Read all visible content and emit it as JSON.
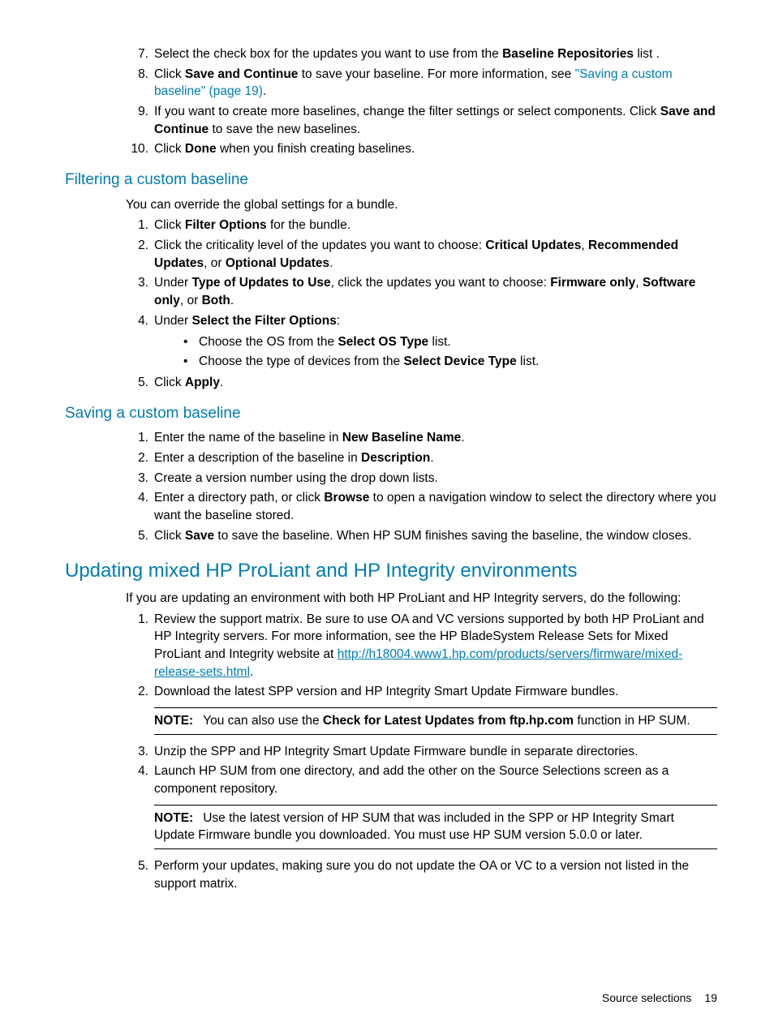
{
  "top_list": {
    "i7": {
      "num": "7.",
      "pre": "Select the check box for the updates you want to use from the ",
      "b1": "Baseline Repositories",
      "post": " list ."
    },
    "i8": {
      "num": "8.",
      "pre": "Click ",
      "b1": "Save and Continue",
      "mid": " to save your baseline. For more information, see ",
      "xref": "\"Saving a custom baseline\" (page 19)",
      "post": "."
    },
    "i9": {
      "num": "9.",
      "pre": "If you want to create more baselines, change the filter settings or select components. Click ",
      "b1": "Save and Continue",
      "post": " to save the new baselines."
    },
    "i10": {
      "num": "10.",
      "pre": "Click ",
      "b1": "Done",
      "post": " when you finish creating baselines."
    }
  },
  "sec_filter": {
    "title": "Filtering a custom baseline",
    "intro": "You can override the global settings for a bundle.",
    "i1": {
      "num": "1.",
      "pre": "Click ",
      "b1": "Filter Options",
      "post": " for the bundle."
    },
    "i2": {
      "num": "2.",
      "pre": "Click the criticality level of the updates you want to choose: ",
      "b1": "Critical Updates",
      "mid1": ", ",
      "b2": "Recommended Updates",
      "mid2": ", or ",
      "b3": "Optional Updates",
      "post": "."
    },
    "i3": {
      "num": "3.",
      "pre": "Under ",
      "b1": "Type of Updates to Use",
      "mid1": ", click the updates you want to choose: ",
      "b2": "Firmware only",
      "mid2": ", ",
      "b3": "Software only",
      "mid3": ", or ",
      "b4": "Both",
      "post": "."
    },
    "i4": {
      "num": "4.",
      "pre": "Under ",
      "b1": "Select the Filter Options",
      "post": ":"
    },
    "i4s1": {
      "pre": "Choose the OS from the ",
      "b1": "Select OS Type",
      "post": " list."
    },
    "i4s2": {
      "pre": "Choose the type of devices from the ",
      "b1": "Select Device Type",
      "post": " list."
    },
    "i5": {
      "num": "5.",
      "pre": "Click ",
      "b1": "Apply",
      "post": "."
    }
  },
  "sec_save": {
    "title": "Saving a custom baseline",
    "i1": {
      "num": "1.",
      "pre": "Enter the name of the baseline in ",
      "b1": "New Baseline Name",
      "post": "."
    },
    "i2": {
      "num": "2.",
      "pre": "Enter a description of the baseline in ",
      "b1": "Description",
      "post": "."
    },
    "i3": {
      "num": "3.",
      "text": "Create a version number using the drop down lists."
    },
    "i4": {
      "num": "4.",
      "pre": "Enter a directory path, or click ",
      "b1": "Browse",
      "post": " to open a navigation window to select the directory where you want the baseline stored."
    },
    "i5": {
      "num": "5.",
      "pre": "Click ",
      "b1": "Save",
      "post": " to save the baseline. When HP SUM finishes saving the baseline, the window closes."
    }
  },
  "sec_update": {
    "title": "Updating mixed HP ProLiant and HP Integrity environments",
    "intro": "If you are updating an environment with both HP ProLiant and HP Integrity servers, do the following:",
    "i1": {
      "num": "1.",
      "pre": "Review the support matrix. Be sure to use OA and VC versions supported by both HP ProLiant and HP Integrity servers. For more information, see the HP BladeSystem Release Sets for Mixed ProLiant and Integrity website at ",
      "link": "http://h18004.www1.hp.com/products/servers/firmware/mixed-release-sets.html",
      "post": "."
    },
    "i2": {
      "num": "2.",
      "text": "Download the latest SPP version and HP Integrity Smart Update Firmware bundles."
    },
    "note1": {
      "label": "NOTE:",
      "pre": "You can also use the ",
      "b1": "Check for Latest Updates from ftp.hp.com",
      "post": " function in HP SUM."
    },
    "i3": {
      "num": "3.",
      "text": "Unzip the SPP and HP Integrity Smart Update Firmware bundle in separate directories."
    },
    "i4": {
      "num": "4.",
      "text": "Launch HP SUM from one directory, and add the other on the Source Selections screen as a component repository."
    },
    "note2": {
      "label": "NOTE:",
      "text": "Use the latest version of HP SUM that was included in the SPP or HP Integrity Smart Update Firmware bundle you downloaded. You must use HP SUM version 5.0.0 or later."
    },
    "i5": {
      "num": "5.",
      "text": "Perform your updates, making sure you do not update the OA or VC to a version not listed in the support matrix."
    }
  },
  "footer": {
    "section": "Source selections",
    "page": "19"
  }
}
